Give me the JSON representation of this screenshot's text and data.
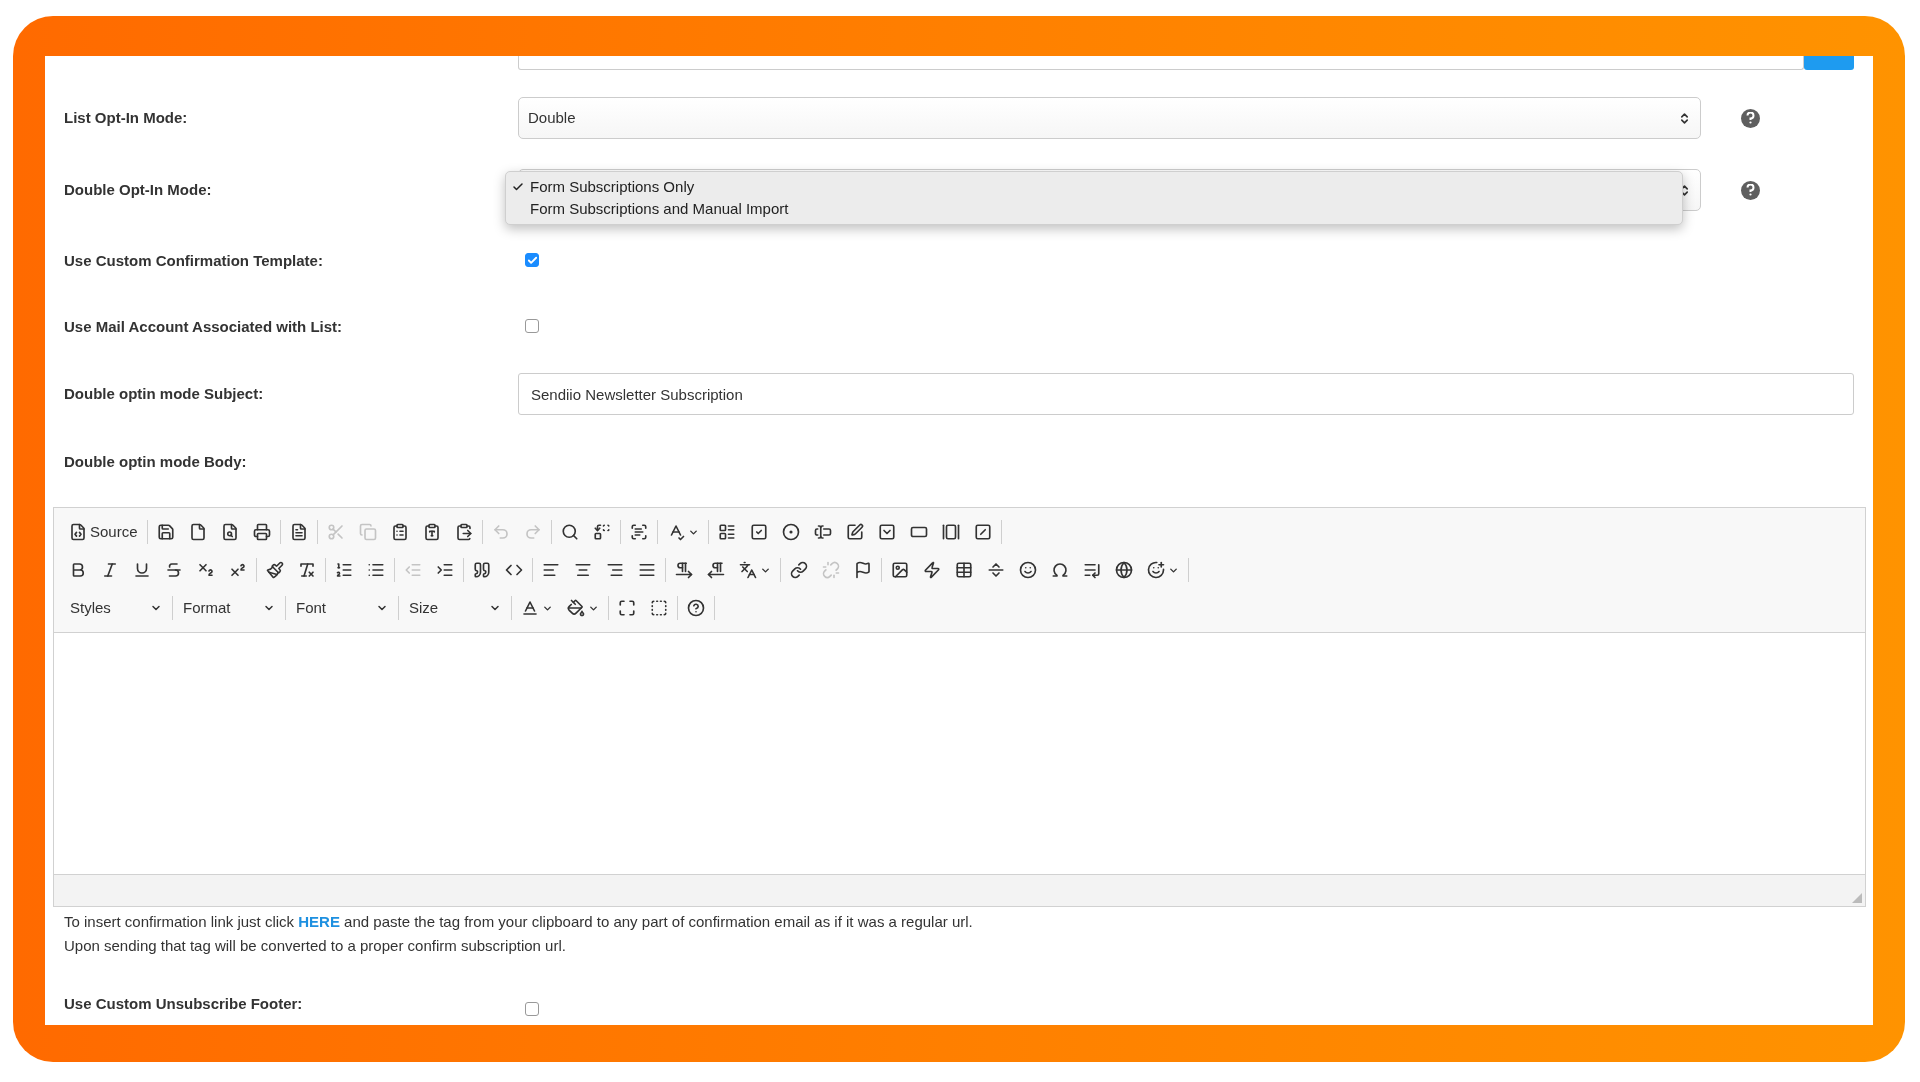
{
  "fields": [
    {
      "label": "List Opt-In Mode:",
      "kind": "select",
      "value": "Double",
      "help": true
    },
    {
      "label": "Double Opt-In Mode:",
      "kind": "select",
      "help": true,
      "menu": [
        {
          "label": "Form Subscriptions Only",
          "selected": true
        },
        {
          "label": "Form Subscriptions and Manual Import",
          "selected": false
        }
      ]
    },
    {
      "label": "Use Custom Confirmation Template:",
      "kind": "checkbox",
      "checked": true
    },
    {
      "label": "Use Mail Account Associated with List:",
      "kind": "checkbox",
      "checked": false
    },
    {
      "label": "Double optin mode Subject:",
      "kind": "text",
      "value": "Sendiio Newsletter Subscription"
    },
    {
      "label": "Double optin mode Body:",
      "kind": "label"
    }
  ],
  "editor": {
    "toolbar": [
      [
        [
          {
            "kind": "source",
            "label": "Source"
          }
        ],
        [
          {
            "kind": "save"
          },
          {
            "kind": "newpage"
          },
          {
            "kind": "preview"
          },
          {
            "kind": "print"
          }
        ],
        [
          {
            "kind": "templates"
          }
        ],
        [
          {
            "kind": "cut",
            "disabled": true
          },
          {
            "kind": "copy",
            "disabled": true
          },
          {
            "kind": "paste"
          },
          {
            "kind": "pastetext"
          },
          {
            "kind": "pasteword"
          }
        ],
        [
          {
            "kind": "undo",
            "disabled": true
          },
          {
            "kind": "redo",
            "disabled": true
          }
        ],
        [
          {
            "kind": "find"
          },
          {
            "kind": "replace"
          }
        ],
        [
          {
            "kind": "selectall"
          }
        ],
        [
          {
            "kind": "spellcheck",
            "menu": true
          }
        ],
        [
          {
            "kind": "form"
          },
          {
            "kind": "checkbox"
          },
          {
            "kind": "radio"
          },
          {
            "kind": "textfield"
          },
          {
            "kind": "textarea"
          },
          {
            "kind": "select"
          },
          {
            "kind": "button"
          },
          {
            "kind": "imagebutton"
          },
          {
            "kind": "hidden"
          }
        ]
      ],
      [
        [
          {
            "kind": "bold"
          },
          {
            "kind": "italic"
          },
          {
            "kind": "underline"
          },
          {
            "kind": "strike"
          },
          {
            "kind": "subscript"
          },
          {
            "kind": "superscript"
          }
        ],
        [
          {
            "kind": "copyformat"
          },
          {
            "kind": "removeformat"
          }
        ],
        [
          {
            "kind": "numbered"
          },
          {
            "kind": "bulleted"
          }
        ],
        [
          {
            "kind": "outdent",
            "disabled": true
          },
          {
            "kind": "indent"
          }
        ],
        [
          {
            "kind": "blockquote"
          },
          {
            "kind": "div"
          }
        ],
        [
          {
            "kind": "alignleft"
          },
          {
            "kind": "aligncenter"
          },
          {
            "kind": "alignright"
          },
          {
            "kind": "justify"
          }
        ],
        [
          {
            "kind": "ltr"
          },
          {
            "kind": "rtl"
          },
          {
            "kind": "language",
            "menu": true
          }
        ],
        [
          {
            "kind": "link"
          },
          {
            "kind": "unlink",
            "disabled": true
          },
          {
            "kind": "anchor"
          }
        ],
        [
          {
            "kind": "image"
          },
          {
            "kind": "flash"
          },
          {
            "kind": "table"
          },
          {
            "kind": "hr"
          },
          {
            "kind": "smiley"
          },
          {
            "kind": "specialchar"
          },
          {
            "kind": "pagebreak"
          },
          {
            "kind": "iframe"
          },
          {
            "kind": "emoji",
            "menu": true
          }
        ]
      ],
      [
        [
          {
            "kind": "combo",
            "label": "Styles"
          }
        ],
        [
          {
            "kind": "combo",
            "label": "Format"
          }
        ],
        [
          {
            "kind": "combo",
            "label": "Font"
          }
        ],
        [
          {
            "kind": "combo",
            "label": "Size"
          }
        ],
        [
          {
            "kind": "textcolor",
            "menu": true
          },
          {
            "kind": "bgcolor",
            "menu": true
          }
        ],
        [
          {
            "kind": "maximize"
          },
          {
            "kind": "showblocks"
          }
        ],
        [
          {
            "kind": "about"
          }
        ]
      ]
    ]
  },
  "note": {
    "before": "To insert confirmation link just click ",
    "link": "HERE",
    "after": " and paste the tag from your clipboard to any part of confirmation email as if it was a regular url.",
    "line2": "Upon sending that tag will be converted to a proper confirm subscription url."
  },
  "footer_field": {
    "label": "Use Custom Unsubscribe Footer:",
    "kind": "checkbox",
    "checked": false
  }
}
